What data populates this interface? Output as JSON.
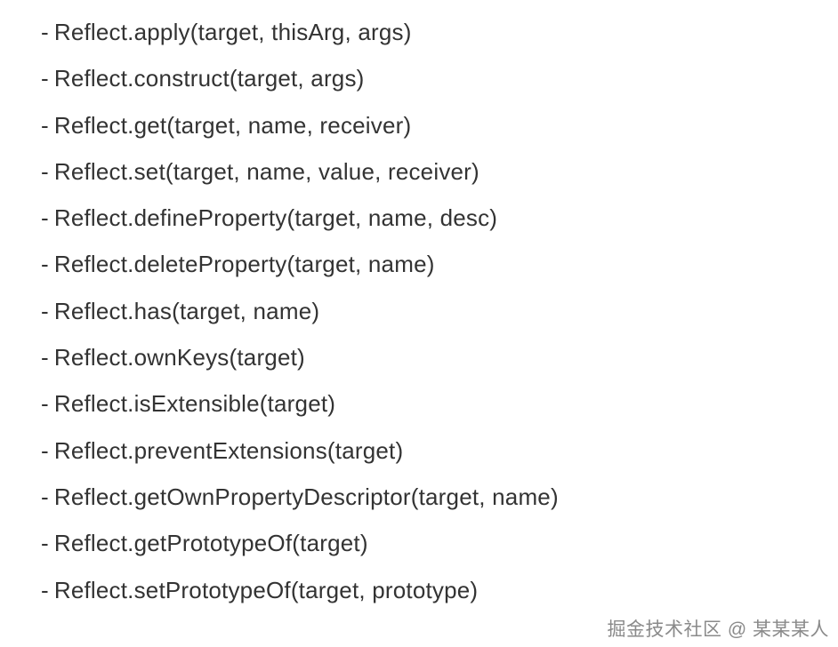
{
  "items": [
    "Reflect.apply(target, thisArg, args)",
    "Reflect.construct(target, args)",
    "Reflect.get(target, name, receiver)",
    "Reflect.set(target, name, value, receiver)",
    "Reflect.defineProperty(target, name, desc)",
    "Reflect.deleteProperty(target, name)",
    "Reflect.has(target, name)",
    "Reflect.ownKeys(target)",
    "Reflect.isExtensible(target)",
    "Reflect.preventExtensions(target)",
    "Reflect.getOwnPropertyDescriptor(target, name)",
    "Reflect.getPrototypeOf(target)",
    "Reflect.setPrototypeOf(target, prototype)"
  ],
  "bullet": "-",
  "watermark": "掘金技术社区 @ 某某某人"
}
